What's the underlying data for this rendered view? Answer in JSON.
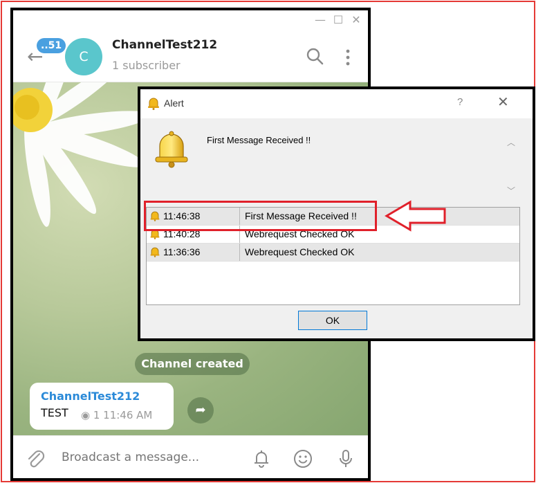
{
  "telegram": {
    "unread_count": "..51",
    "avatar_letter": "C",
    "channel_name": "ChannelTest212",
    "subscribers": "1 subscriber",
    "service_message": "Channel created",
    "message": {
      "author": "ChannelTest212",
      "text": "TEST",
      "meta": "◉ 1  11:46 AM"
    },
    "input_placeholder": "Broadcast a message...",
    "icons": [
      "back-arrow-icon",
      "search-icon",
      "more-icon",
      "forward-icon",
      "attach-icon",
      "bell-icon",
      "emoji-icon",
      "microphone-icon"
    ]
  },
  "alert": {
    "title": "Alert",
    "help": "?",
    "close": "✕",
    "message": "First Message Received !!",
    "rows": [
      {
        "time": "11:46:38",
        "text": "First Message Received !!"
      },
      {
        "time": "11:40:28",
        "text": "Webrequest Checked OK"
      },
      {
        "time": "11:36:36",
        "text": "Webrequest Checked OK"
      }
    ],
    "ok_label": "OK"
  },
  "colors": {
    "frame": "#e53935",
    "accent_blue": "#2b8ad8",
    "avatar": "#5ac6cc",
    "highlight": "#e0202a"
  }
}
